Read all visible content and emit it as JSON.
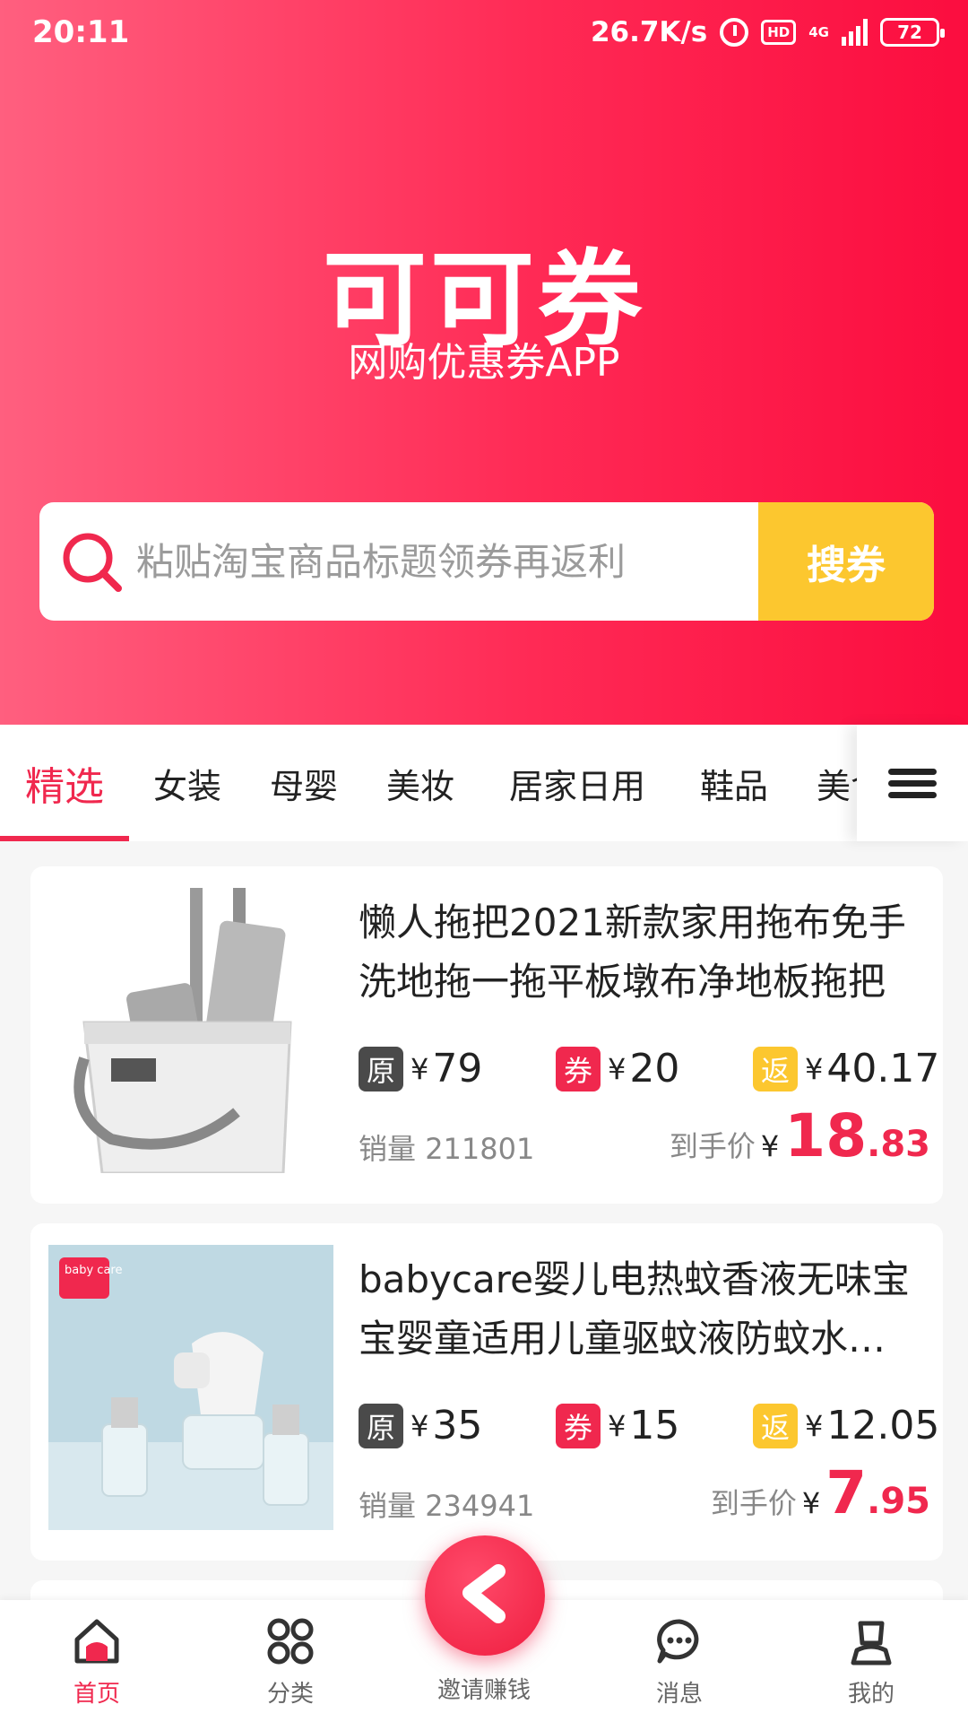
{
  "status_bar": {
    "time": "20:11",
    "speed": "26.7K/s",
    "hd": "HD",
    "network": "4G",
    "battery": "72"
  },
  "brand": {
    "title": "可可券",
    "subtitle": "网购优惠券APP"
  },
  "search": {
    "placeholder": "粘贴淘宝商品标题领券再返利",
    "button_label": "搜券"
  },
  "tabs": [
    "精选",
    "女装",
    "母婴",
    "美妆",
    "居家日用",
    "鞋品",
    "美食"
  ],
  "active_tab": "精选",
  "products": [
    {
      "title": "懒人拖把2021新款家用拖布免手洗地拖一拖平板墩布净地板拖把",
      "original_tag": "原",
      "original_price": "79",
      "coupon_tag": "券",
      "coupon": "20",
      "rebate_tag": "返",
      "rebate": "40.17",
      "sales_label": "销量",
      "sales": "211801",
      "final_label": "到手价",
      "final_int": "18",
      "final_dec": ".83",
      "image": "mop-bucket"
    },
    {
      "title": "babycare婴儿电热蚊香液无味宝宝婴童适用儿童驱蚊液防蚊水套装",
      "original_tag": "原",
      "original_price": "35",
      "coupon_tag": "券",
      "coupon": "15",
      "rebate_tag": "返",
      "rebate": "12.05",
      "sales_label": "销量",
      "sales": "234941",
      "final_label": "到手价",
      "final_int": "7",
      "final_dec": ".95",
      "image": "mosquito-repellent",
      "image_badge": "baby care"
    }
  ],
  "currency": "¥",
  "bottom_nav": [
    {
      "label": "首页",
      "icon": "home-icon"
    },
    {
      "label": "分类",
      "icon": "category-icon"
    },
    {
      "label": "邀请赚钱",
      "icon": "share-icon"
    },
    {
      "label": "消息",
      "icon": "message-icon"
    },
    {
      "label": "我的",
      "icon": "profile-icon"
    }
  ],
  "colors": {
    "accent": "#f0284e",
    "search_button": "#fcc72f",
    "original_tag": "#4a4a4a",
    "coupon_tag": "#f0284e",
    "rebate_tag": "#fcc72f"
  }
}
